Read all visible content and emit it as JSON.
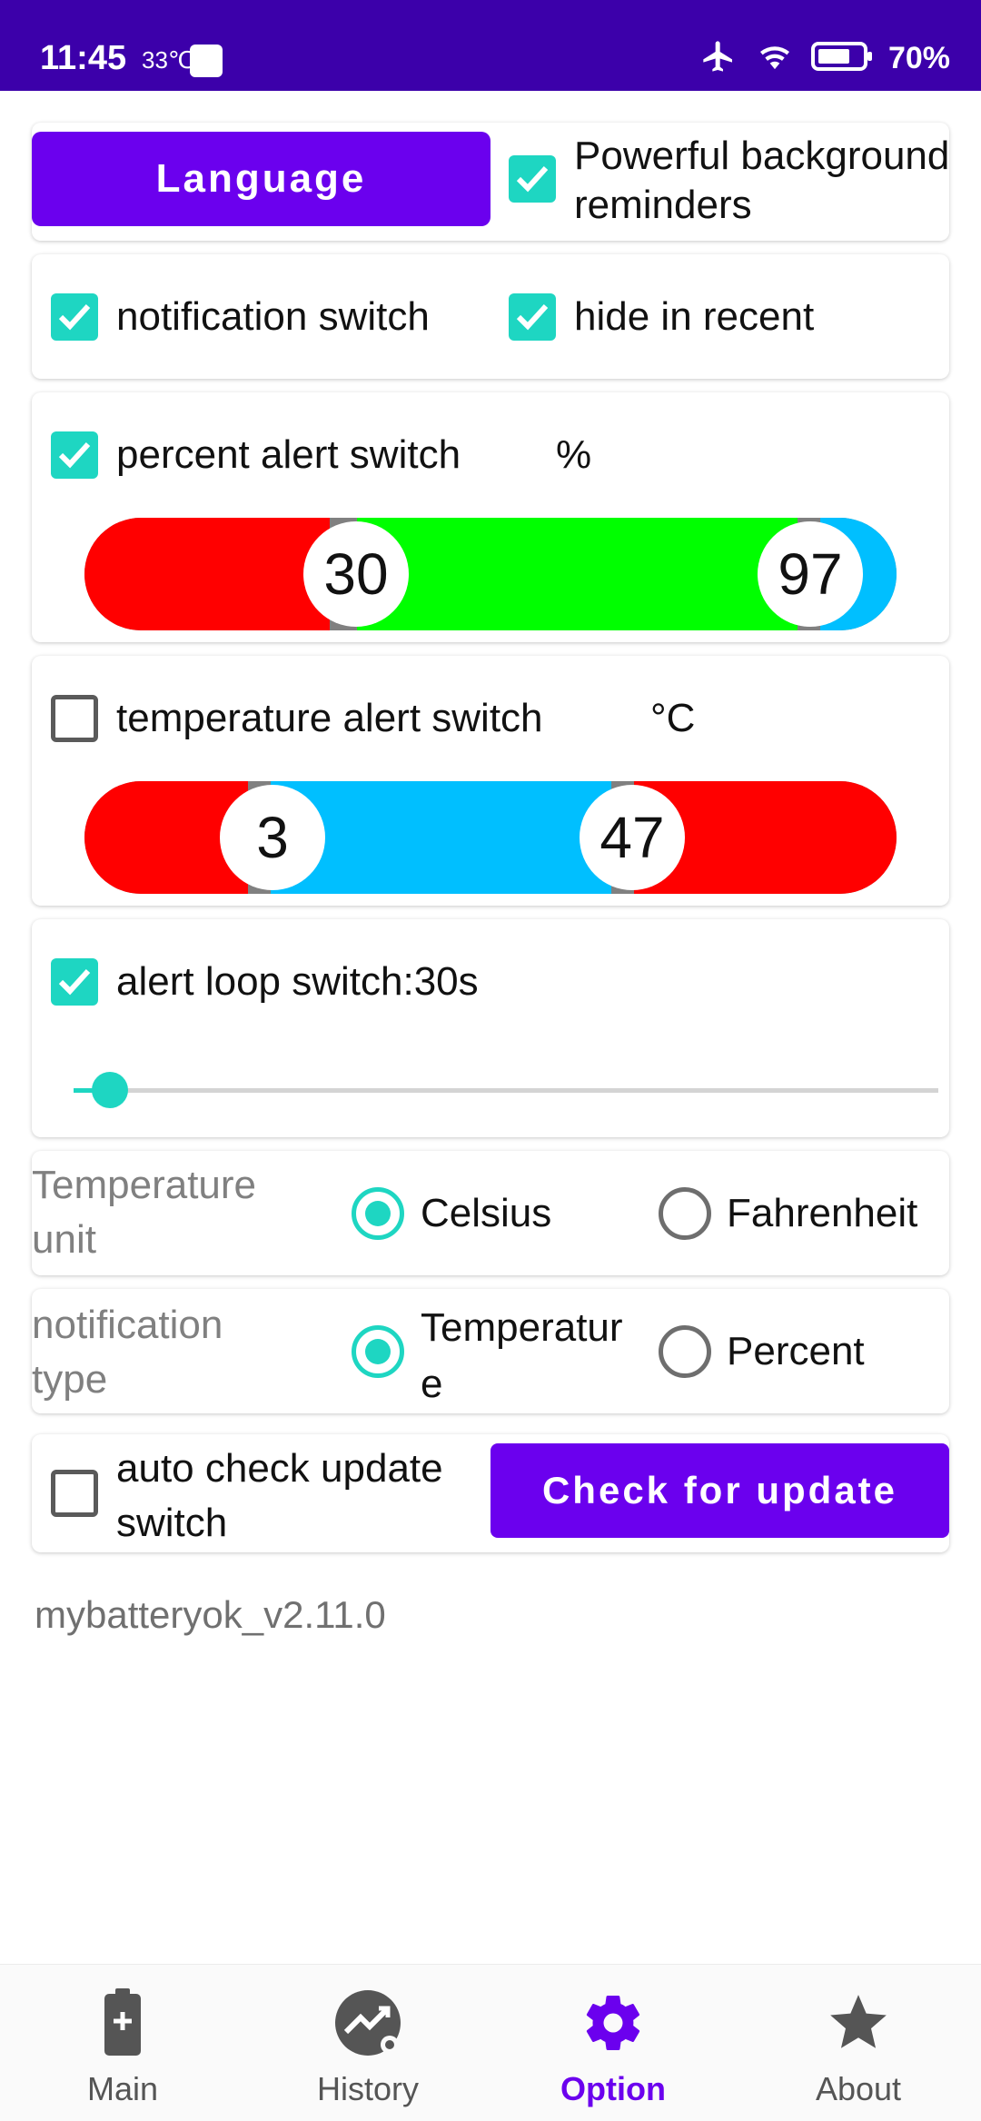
{
  "status_bar": {
    "time": "11:45",
    "temperature": "33℃",
    "battery_percent": "70%"
  },
  "options": {
    "language_button": "Language",
    "powerful_reminders": {
      "label": "Powerful background reminders",
      "checked": true
    },
    "notification_switch": {
      "label": "notification switch",
      "checked": true
    },
    "hide_in_recent": {
      "label": "hide in recent",
      "checked": true
    },
    "percent_alert": {
      "label": "percent alert switch",
      "unit": "%",
      "checked": true,
      "low": "30",
      "high": "97",
      "colors": {
        "low": "#ff0000",
        "mid": "#00ff00",
        "high": "#00bfff"
      }
    },
    "temperature_alert": {
      "label": "temperature alert switch",
      "unit": "°C",
      "checked": false,
      "low": "3",
      "high": "47",
      "colors": {
        "low": "#ff0000",
        "mid": "#00bfff",
        "high": "#ff0000"
      }
    },
    "alert_loop": {
      "label": "alert loop switch:30s",
      "checked": true,
      "slider_fraction": 0.03
    },
    "temperature_unit": {
      "label": "Temperature unit",
      "options": [
        "Celsius",
        "Fahrenheit"
      ],
      "selected": "Celsius"
    },
    "notification_type": {
      "label": "notification type",
      "options": [
        "Temperature",
        "Percent"
      ],
      "selected": "Temperature"
    },
    "auto_check_update": {
      "label": "auto check update switch",
      "checked": false
    },
    "check_update_button": "Check for update",
    "version": "mybatteryok_v2.11.0"
  },
  "bottom_nav": {
    "items": [
      {
        "label": "Main",
        "icon": "battery-icon"
      },
      {
        "label": "History",
        "icon": "history-chart-icon"
      },
      {
        "label": "Option",
        "icon": "gear-icon"
      },
      {
        "label": "About",
        "icon": "star-icon"
      }
    ],
    "active": "Option"
  },
  "colors": {
    "accent": "#6b00ee",
    "check": "#1ed6c2",
    "status_bar": "#3c00aa"
  }
}
